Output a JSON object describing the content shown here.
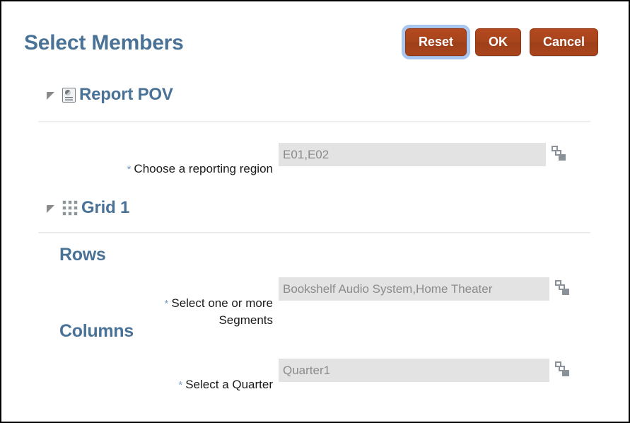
{
  "dialog": {
    "title": "Select Members",
    "accent_blue": "#4a7296",
    "button_color": "#a7441c",
    "input_background": "#e3e3e3",
    "required_marker": "*"
  },
  "buttons": [
    {
      "label": "Reset",
      "name": "reset-button",
      "focused": true
    },
    {
      "label": "OK",
      "name": "ok-button",
      "focused": false
    },
    {
      "label": "Cancel",
      "name": "cancel-button",
      "focused": false
    }
  ],
  "sections": [
    {
      "title": "Report POV",
      "icon": "report-icon",
      "expanded": true,
      "fields": [
        {
          "label": "Choose a reporting region",
          "required": true,
          "value": "E01,E02",
          "selector_icon": "member-selector-icon"
        }
      ]
    },
    {
      "title": "Grid 1",
      "icon": "grid-icon",
      "expanded": true,
      "groups": [
        {
          "heading": "Rows",
          "fields": [
            {
              "label": "Select one or more\nSegments",
              "required": true,
              "value": "Bookshelf Audio System,Home Theater",
              "selector_icon": "member-selector-icon"
            }
          ]
        },
        {
          "heading": "Columns",
          "fields": [
            {
              "label": "Select a Quarter",
              "required": true,
              "value": "Quarter1",
              "selector_icon": "member-selector-icon"
            }
          ]
        }
      ]
    }
  ]
}
